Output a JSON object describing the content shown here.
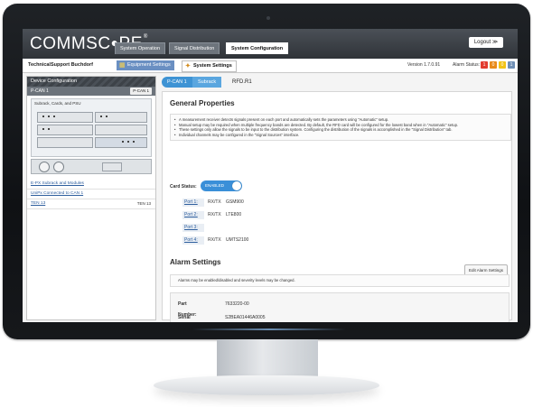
{
  "header": {
    "logo": "COMMSC",
    "logo_o": "●",
    "logo_tail": "PE",
    "logo_reg": "®",
    "tabs": [
      {
        "label": "System Operation"
      },
      {
        "label": "Signal Distribution"
      },
      {
        "label": "System Configuration"
      }
    ],
    "logout_label": "Logout ≫"
  },
  "subheader": {
    "user": "TechnicalSupport Buchdorf",
    "equipment_tab": "Equipment Settings",
    "system_tab": "System Settings",
    "version": "Version 1.7.0.91",
    "alarm_status_label": "Alarm Status:",
    "alarm_indicators": [
      {
        "count": "1",
        "color": "#e23b2e"
      },
      {
        "count": "0",
        "color": "#e88a1a"
      },
      {
        "count": "0",
        "color": "#f2c318"
      },
      {
        "count": "1",
        "color": "#6f8fb5"
      }
    ]
  },
  "left_panel": {
    "title": "Device Configuration",
    "device_row": "P-CAN 1",
    "device_badge": "P-CAN 1",
    "subrack_label": "Subrack, Cards, and PSU",
    "links": [
      {
        "label": "E-PX Subrack and Modules",
        "tail": ""
      },
      {
        "label": "UniPx Connected to CAN 1",
        "tail": ""
      },
      {
        "label": "TEN 13",
        "tail": "TEN 13"
      }
    ]
  },
  "breadcrumb": [
    "P-CAN 1",
    "Subrack",
    "RFD.R1"
  ],
  "general": {
    "title": "General Properties",
    "notes": [
      "A measurement receiver detects signals present on each port and automatically sets the parameters using \"Automatic\" setup.",
      "Manual setup may be required when multiple frequency bands are detected. By default, the RFD card will be configured for the lowest band when in \"Automatic\" setup.",
      "These settings only allow the signals to be input to the distribution system. Configuring the distribution of the signals is accomplished in the \"Signal Distribution\" tab.",
      "Individual channels may be configured in the \"Signal Sources\" interface."
    ],
    "card_status_label": "Card Status:",
    "card_status_value": "ENABLED",
    "ports": [
      {
        "name": "Port 1:",
        "dir": "RX/TX",
        "band": "GSM900"
      },
      {
        "name": "Port 2:",
        "dir": "RX/TX",
        "band": "LTE800"
      },
      {
        "name": "Port 3:",
        "dir": "",
        "band": ""
      },
      {
        "name": "Port 4:",
        "dir": "RX/TX",
        "band": "UMTS2100"
      }
    ]
  },
  "alarm": {
    "title": "Alarm Settings",
    "note": "Alarms may be enabled/disabled and severity levels may be changed.",
    "edit_button": "Edit Alarm Settings"
  },
  "info": {
    "part_number_label": "Part Number:",
    "part_number": "7633220-00",
    "serial_number_label": "Serial Number:",
    "serial_number": "S2BEA01446A0005"
  },
  "colors": {
    "header_dark": "#2f3338",
    "accent_blue": "#3a8fd8",
    "equipment_tab_blue": "#6a8fc2",
    "link_blue": "#2f5f9e"
  }
}
